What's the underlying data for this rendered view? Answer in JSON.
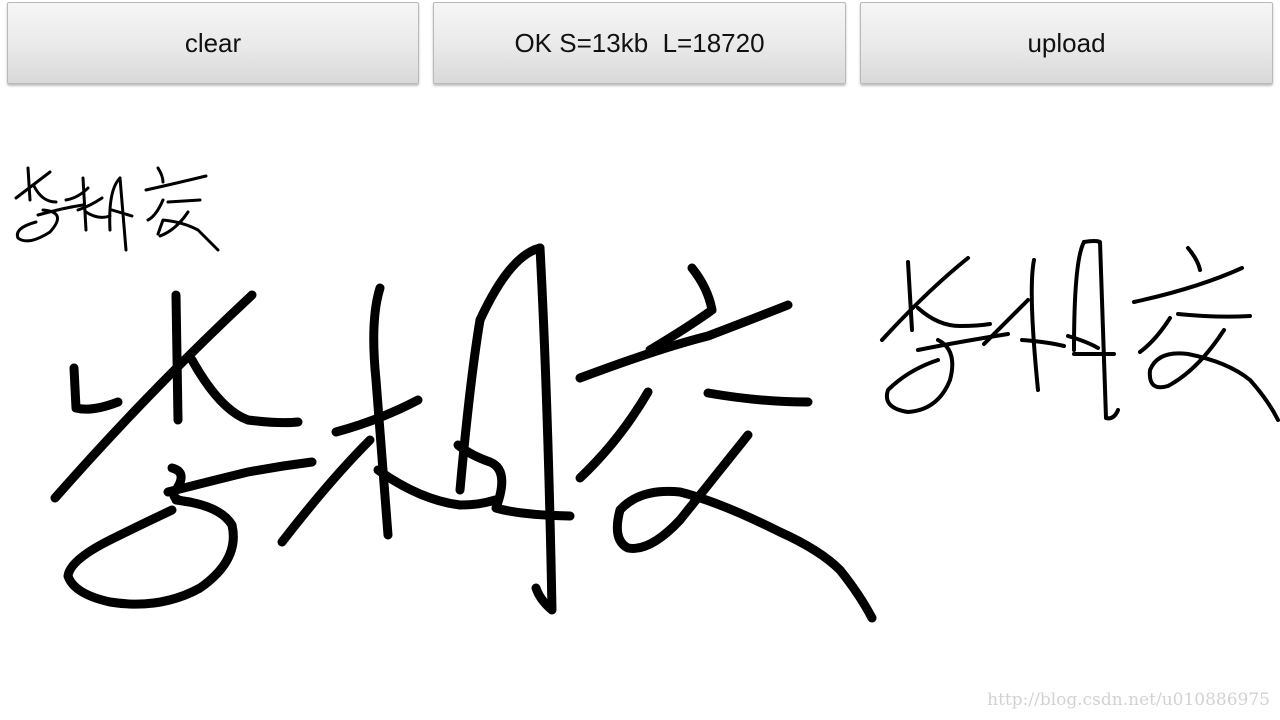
{
  "toolbar": {
    "clear_label": "clear",
    "ok_label": "OK S=13kb  L=18720",
    "upload_label": "upload"
  },
  "signature": {
    "image_name": "handwritten-signature",
    "stroke_color": "#000000"
  },
  "watermark": {
    "text": "http://blog.csdn.net/u010886975"
  }
}
